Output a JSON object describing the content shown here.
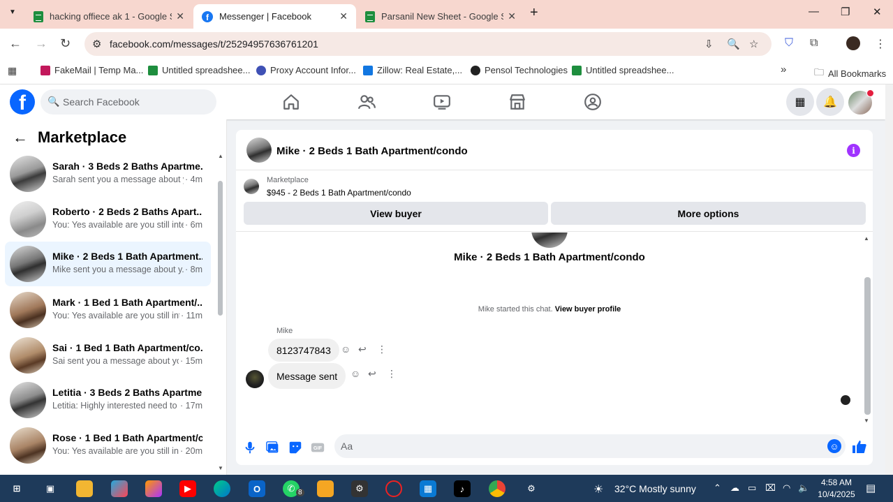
{
  "browser": {
    "tabs": [
      {
        "title": "hacking offiece ak 1 - Google Sh",
        "active": false
      },
      {
        "title": "Messenger | Facebook",
        "active": true
      },
      {
        "title": "Parsanil New Sheet - Google Sh",
        "active": false
      }
    ],
    "url": "facebook.com/messages/t/25294957636761201",
    "bookmarks": [
      {
        "label": "FakeMail | Temp Ma...",
        "color": "#c2185b"
      },
      {
        "label": "Untitled spreadshee...",
        "color": "#1e8e3e"
      },
      {
        "label": "Proxy Account Infor...",
        "color": "#3f51b5"
      },
      {
        "label": "Zillow: Real Estate,...",
        "color": "#1277e1"
      },
      {
        "label": "Pensol Technologies",
        "color": "#222222"
      },
      {
        "label": "Untitled spreadshee...",
        "color": "#1e8e3e"
      }
    ],
    "all_bookmarks": "All Bookmarks"
  },
  "facebook": {
    "logo": "f",
    "search_placeholder": "Search Facebook"
  },
  "marketplace": {
    "title": "Marketplace",
    "conversations": [
      {
        "name": "Sarah · 3 Beds 2 Baths Apartme...",
        "snippet": "Sarah sent you a message about y...",
        "time": "· 4m",
        "active": false
      },
      {
        "name": "Roberto · 2 Beds 2 Baths Apart...",
        "snippet": "You: Yes available are you still inter...",
        "time": "· 6m",
        "active": false
      },
      {
        "name": "Mike · 2 Beds 1 Bath Apartment...",
        "snippet": "Mike sent you a message about y...",
        "time": "· 8m",
        "active": true
      },
      {
        "name": "Mark · 1 Bed 1 Bath Apartment/...",
        "snippet": "You: Yes available are you still int...",
        "time": "· 11m",
        "active": false
      },
      {
        "name": "Sai · 1 Bed 1 Bath Apartment/co...",
        "snippet": "Sai sent you a message about yo...",
        "time": "· 15m",
        "active": false
      },
      {
        "name": "Letitia · 3 Beds 2 Baths Apartme...",
        "snippet": "Letitia: Highly interested need to ...",
        "time": "· 17m",
        "active": false
      },
      {
        "name": "Rose · 1 Bed 1 Bath Apartment/c...",
        "snippet": "You: Yes available are you still int...",
        "time": "· 20m",
        "active": false
      }
    ]
  },
  "chat": {
    "header_name": "Mike · 2 Beds 1 Bath Apartment/condo",
    "marketplace_label": "Marketplace",
    "listing": "$945 - 2 Beds 1 Bath Apartment/condo",
    "view_buyer": "View buyer",
    "more_options": "More options",
    "center_name": "Mike · 2 Beds 1 Bath Apartment/condo",
    "started_text": "Mike started this chat.",
    "view_buyer_profile": "View buyer profile",
    "sender": "Mike",
    "messages": [
      {
        "text": "8123747843"
      },
      {
        "text": "Message sent"
      }
    ],
    "composer_placeholder": "Aa"
  },
  "taskbar": {
    "weather": "32°C  Mostly sunny",
    "time": "4:58 AM",
    "date": "10/4/2025",
    "whatsapp_badge": "8"
  }
}
